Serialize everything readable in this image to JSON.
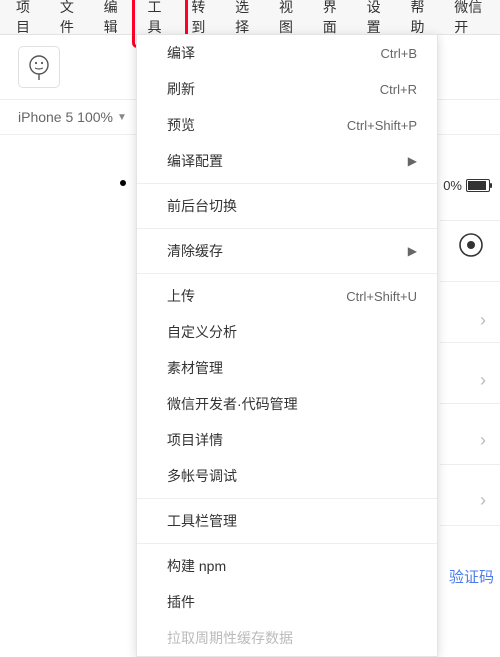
{
  "menubar": {
    "items": [
      "项目",
      "文件",
      "编辑",
      "工具",
      "转到",
      "选择",
      "视图",
      "界面",
      "设置",
      "帮助",
      "微信开"
    ]
  },
  "device": {
    "label": "iPhone 5 100%"
  },
  "battery": {
    "percent_label": "0%"
  },
  "bottom_link": "验证码",
  "dropdown": {
    "groups": [
      [
        {
          "label": "编译",
          "shortcut": "Ctrl+B"
        },
        {
          "label": "刷新",
          "shortcut": "Ctrl+R"
        },
        {
          "label": "预览",
          "shortcut": "Ctrl+Shift+P"
        },
        {
          "label": "编译配置",
          "submenu": true
        }
      ],
      [
        {
          "label": "前后台切换"
        }
      ],
      [
        {
          "label": "清除缓存",
          "submenu": true
        }
      ],
      [
        {
          "label": "上传",
          "shortcut": "Ctrl+Shift+U"
        },
        {
          "label": "自定义分析"
        },
        {
          "label": "素材管理"
        },
        {
          "label": "微信开发者·代码管理"
        },
        {
          "label": "项目详情"
        },
        {
          "label": "多帐号调试"
        }
      ],
      [
        {
          "label": "工具栏管理"
        }
      ],
      [
        {
          "label": "构建 npm",
          "highlight": true
        },
        {
          "label": "插件"
        },
        {
          "label": "拉取周期性缓存数据",
          "disabled": true
        }
      ]
    ]
  },
  "highlight_menu_index": 3
}
